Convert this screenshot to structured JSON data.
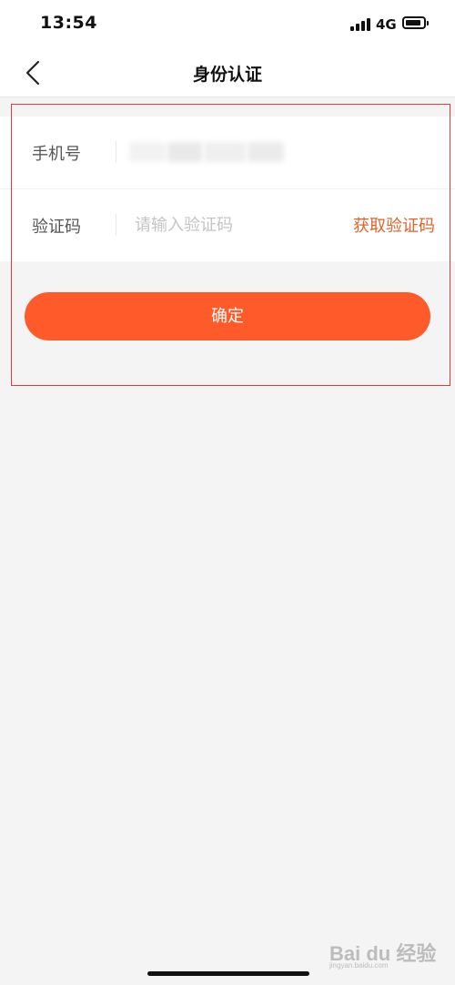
{
  "status_bar": {
    "time": "13:54",
    "network": "4G",
    "signal_icon": "cellular-signal-icon",
    "battery_icon": "battery-icon"
  },
  "nav": {
    "back_icon": "chevron-left-icon",
    "title": "身份认证"
  },
  "form": {
    "phone": {
      "label": "手机号",
      "value_hidden": true
    },
    "code": {
      "label": "验证码",
      "placeholder": "请输入验证码",
      "value": "",
      "get_code_label": "获取验证码"
    }
  },
  "confirm_button": {
    "label": "确定"
  },
  "watermark": {
    "text": "Bai du 经验",
    "sub": "jingyan.baidu.com"
  },
  "colors": {
    "accent": "#ff5a2a",
    "link": "#e0642a",
    "highlight": "#e23a3a",
    "background": "#f4f4f4"
  }
}
